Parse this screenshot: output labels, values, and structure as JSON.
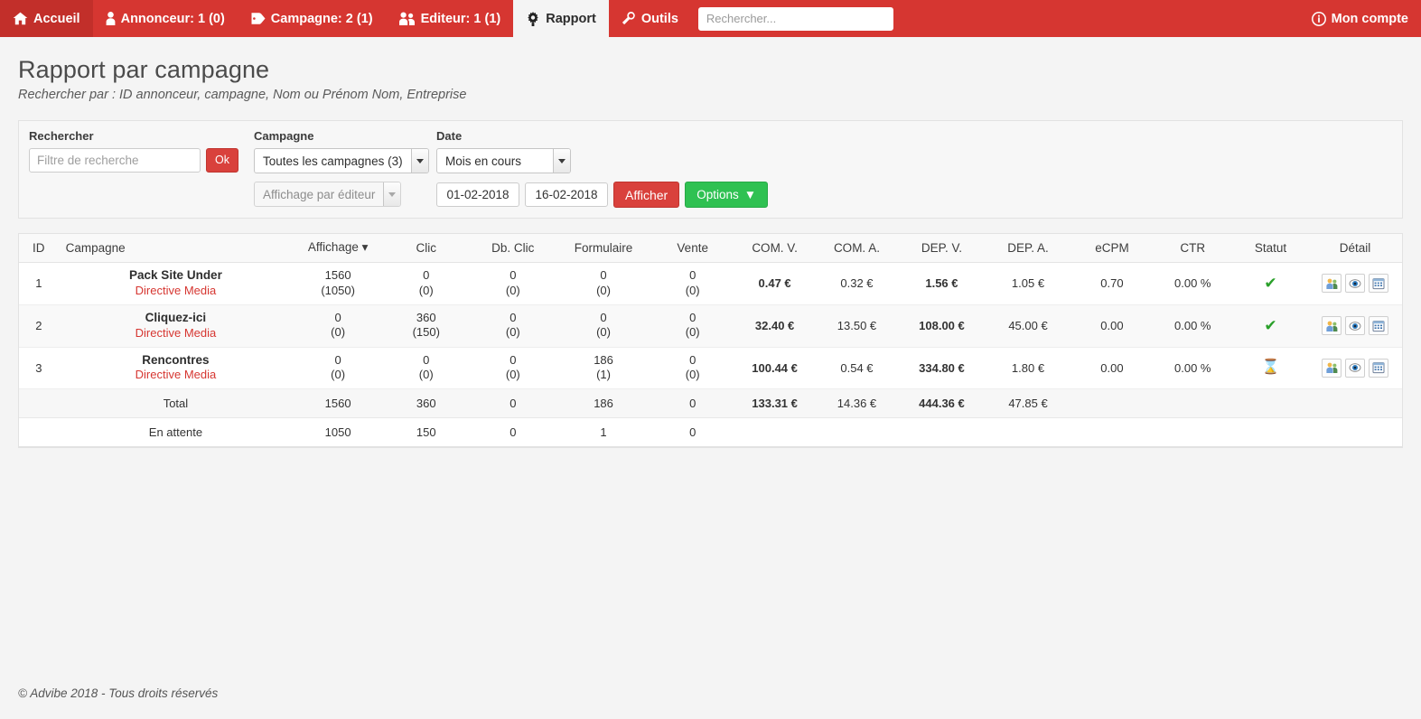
{
  "navbar": {
    "bg_color": "#d63631",
    "items": [
      {
        "label": "Accueil",
        "icon": "home-icon",
        "active": false
      },
      {
        "label": "Annonceur: 1 (0)",
        "icon": "user-icon",
        "active": false
      },
      {
        "label": "Campagne: 2 (1)",
        "icon": "tag-icon",
        "active": false
      },
      {
        "label": "Editeur: 1 (1)",
        "icon": "users-icon",
        "active": false
      },
      {
        "label": "Rapport",
        "icon": "gear-icon",
        "active": true
      },
      {
        "label": "Outils",
        "icon": "wrench-icon",
        "active": false
      }
    ],
    "search_placeholder": "Rechercher...",
    "search_value": "",
    "account_label": "Mon compte",
    "account_icon": "info-circle-icon"
  },
  "header": {
    "title": "Rapport par campagne",
    "subtitle": "Rechercher par : ID annonceur, campagne, Nom ou Prénom Nom, Entreprise"
  },
  "filters": {
    "rechercher_label": "Rechercher",
    "search_placeholder": "Filtre de recherche",
    "search_value": "",
    "ok_label": "Ok",
    "campagne_label": "Campagne",
    "campagne_selected": "Toutes les campagnes (3)",
    "editeur_selected": "Affichage par éditeur",
    "date_label": "Date",
    "date_selected": "Mois en cours",
    "date_from": "01-02-2018",
    "date_to": "16-02-2018",
    "afficher_label": "Afficher",
    "options_label": "Options",
    "options_icon": "chevron-down-icon"
  },
  "table": {
    "columns": [
      {
        "key": "id",
        "label": "ID",
        "align": "center"
      },
      {
        "key": "campagne",
        "label": "Campagne",
        "align": "left"
      },
      {
        "key": "affichage",
        "label": "Affichage ▾",
        "align": "center",
        "sorted": true
      },
      {
        "key": "clic",
        "label": "Clic",
        "align": "center"
      },
      {
        "key": "dbclic",
        "label": "Db. Clic",
        "align": "center"
      },
      {
        "key": "formulaire",
        "label": "Formulaire",
        "align": "center"
      },
      {
        "key": "vente",
        "label": "Vente",
        "align": "center"
      },
      {
        "key": "comv",
        "label": "COM. V.",
        "align": "center"
      },
      {
        "key": "coma",
        "label": "COM. A.",
        "align": "center"
      },
      {
        "key": "depv",
        "label": "DEP. V.",
        "align": "center"
      },
      {
        "key": "depa",
        "label": "DEP. A.",
        "align": "center"
      },
      {
        "key": "ecpm",
        "label": "eCPM",
        "align": "center"
      },
      {
        "key": "ctr",
        "label": "CTR",
        "align": "center"
      },
      {
        "key": "statut",
        "label": "Statut",
        "align": "center"
      },
      {
        "key": "detail",
        "label": "Détail",
        "align": "center"
      }
    ],
    "rows": [
      {
        "id": "1",
        "campagne": "Pack Site Under",
        "annonceur": "Directive Media",
        "affichage": "1560",
        "affichage_sub": "(1050)",
        "clic": "0",
        "clic_sub": "(0)",
        "dbclic": "0",
        "dbclic_sub": "(0)",
        "formulaire": "0",
        "formulaire_sub": "(0)",
        "vente": "0",
        "vente_sub": "(0)",
        "comv": "0.47 €",
        "coma": "0.32 €",
        "depv": "1.56 €",
        "depa": "1.05 €",
        "ecpm": "0.70",
        "ctr": "0.00 %",
        "statut": "valide",
        "statut_icon": "check-icon"
      },
      {
        "id": "2",
        "campagne": "Cliquez-ici",
        "annonceur": "Directive Media",
        "affichage": "0",
        "affichage_sub": "(0)",
        "clic": "360",
        "clic_sub": "(150)",
        "dbclic": "0",
        "dbclic_sub": "(0)",
        "formulaire": "0",
        "formulaire_sub": "(0)",
        "vente": "0",
        "vente_sub": "(0)",
        "comv": "32.40 €",
        "coma": "13.50 €",
        "depv": "108.00 €",
        "depa": "45.00 €",
        "ecpm": "0.00",
        "ctr": "0.00 %",
        "statut": "valide",
        "statut_icon": "check-icon"
      },
      {
        "id": "3",
        "campagne": "Rencontres",
        "annonceur": "Directive Media",
        "affichage": "0",
        "affichage_sub": "(0)",
        "clic": "0",
        "clic_sub": "(0)",
        "dbclic": "0",
        "dbclic_sub": "(0)",
        "formulaire": "186",
        "formulaire_sub": "(1)",
        "vente": "0",
        "vente_sub": "(0)",
        "comv": "100.44 €",
        "coma": "0.54 €",
        "depv": "334.80 €",
        "depa": "1.80 €",
        "ecpm": "0.00",
        "ctr": "0.00 %",
        "statut": "en-attente",
        "statut_icon": "hourglass-icon"
      }
    ],
    "detail_icons": [
      {
        "name": "users-detail-icon",
        "title": "Editeurs"
      },
      {
        "name": "eye-preview-icon",
        "title": "Aperçu"
      },
      {
        "name": "calendar-detail-icon",
        "title": "Détail par jour"
      }
    ],
    "total_row": {
      "label": "Total",
      "affichage": "1560",
      "clic": "360",
      "dbclic": "0",
      "formulaire": "186",
      "vente": "0",
      "comv": "133.31 €",
      "coma": "14.36 €",
      "depv": "444.36 €",
      "depa": "47.85 €",
      "ecpm": "",
      "ctr": ""
    },
    "pending_row": {
      "label": "En attente",
      "affichage": "1050",
      "clic": "150",
      "dbclic": "0",
      "formulaire": "1",
      "vente": "0",
      "comv": "",
      "coma": "",
      "depv": "",
      "depa": "",
      "ecpm": "",
      "ctr": ""
    }
  },
  "footer": {
    "copyright": "© Advibe 2018 - Tous droits réservés"
  }
}
